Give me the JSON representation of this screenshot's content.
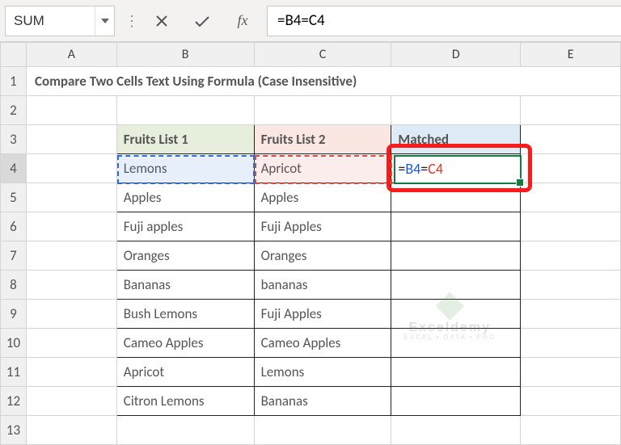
{
  "namebox": "SUM",
  "formula": "=B4=C4",
  "columns": [
    "A",
    "B",
    "C",
    "D",
    "E"
  ],
  "rows": [
    "1",
    "2",
    "3",
    "4",
    "5",
    "6",
    "7",
    "8",
    "9",
    "10",
    "11",
    "12",
    "13"
  ],
  "title": "Compare Two Cells Text Using Formula (Case Insensitive)",
  "headers": {
    "b": "Fruits List 1",
    "c": "Fruits List 2",
    "d": "Matched"
  },
  "data": [
    {
      "b": "Lemons",
      "c": "Apricot"
    },
    {
      "b": "Apples",
      "c": "Apples"
    },
    {
      "b": "Fuji apples",
      "c": "Fuji Apples"
    },
    {
      "b": "Oranges",
      "c": "Oranges"
    },
    {
      "b": "Bananas",
      "c": "bananas"
    },
    {
      "b": "Bush Lemons",
      "c": "Fuji Apples"
    },
    {
      "b": "Cameo Apples",
      "c": "Cameo Apples"
    },
    {
      "b": "Apricot",
      "c": "Lemons"
    },
    {
      "b": "Citron Lemons",
      "c": "Bananas"
    }
  ],
  "d4": {
    "prefix": "=",
    "ref1": "B4",
    "mid": "=",
    "ref2": "C4"
  },
  "watermark": {
    "brand": "Exceldemy",
    "tag": "EXCEL • DATA • PRO"
  }
}
